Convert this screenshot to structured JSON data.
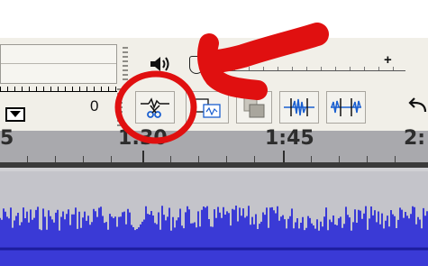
{
  "window": {
    "title": ""
  },
  "meter": {
    "zero_label": "0"
  },
  "toolbar": {
    "buttons": [
      {
        "name": "split-button",
        "icon": "scissors-split-icon"
      },
      {
        "name": "split-new-button",
        "icon": "split-new-icon"
      },
      {
        "name": "copy-button",
        "icon": "copy-icon"
      },
      {
        "name": "silence-button",
        "icon": "silence-audio-icon"
      },
      {
        "name": "trim-button",
        "icon": "trim-audio-icon"
      }
    ],
    "undo_icon": "undo-icon"
  },
  "volume": {
    "icon": "speaker-icon",
    "plus_label": "+"
  },
  "timeline": {
    "labels": [
      "5",
      "1:30",
      "1:45",
      "2:"
    ]
  },
  "annotation": {
    "circle_color": "#e01010",
    "arrow_color": "#e01010"
  },
  "colors": {
    "waveform": "#3a3ad6",
    "waveform_dark": "#1c1c9c",
    "timeline_bg": "#a9a9ad",
    "toolbar_bg": "#f1efe8"
  }
}
